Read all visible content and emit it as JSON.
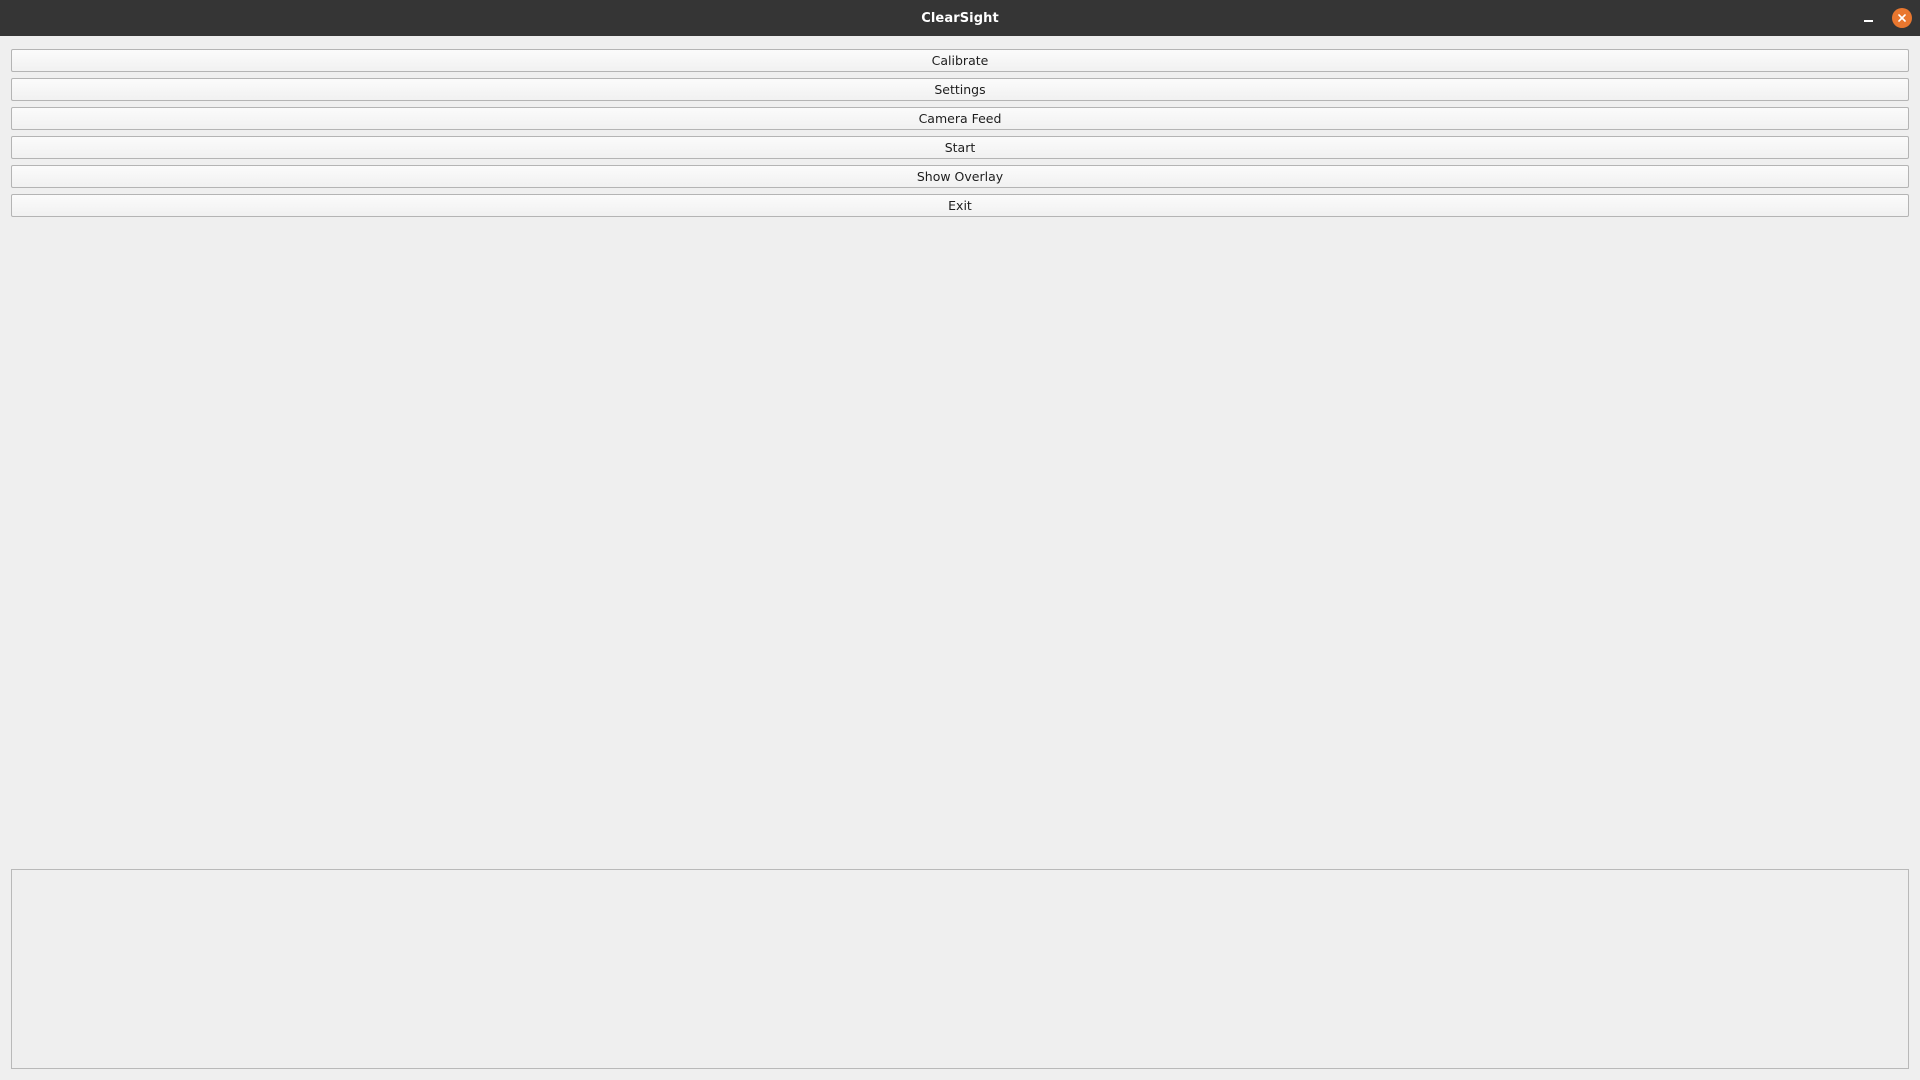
{
  "window": {
    "title": "ClearSight",
    "accent_close": "#e9772f",
    "titlebar_color": "#353535",
    "controls": {
      "minimize_icon": "minimize-icon",
      "close_icon": "close-icon"
    }
  },
  "buttons": [
    {
      "label": "Calibrate"
    },
    {
      "label": "Settings"
    },
    {
      "label": "Camera Feed"
    },
    {
      "label": "Start"
    },
    {
      "label": "Show Overlay"
    },
    {
      "label": "Exit"
    }
  ],
  "output": {
    "text": ""
  }
}
